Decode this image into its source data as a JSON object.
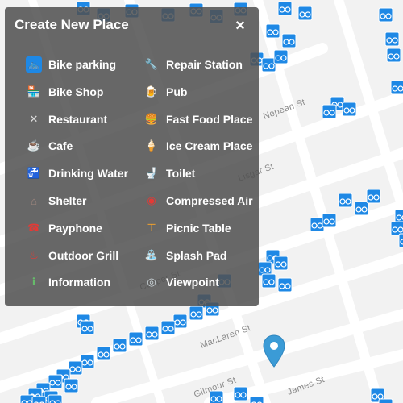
{
  "dialog": {
    "title": "Create New Place",
    "close_label": "×"
  },
  "place_types": [
    {
      "label": "Bike parking",
      "icon": "bike-parking-icon",
      "color": "#1e88e5"
    },
    {
      "label": "Repair Station",
      "icon": "repair-station-icon",
      "color": "#1e88e5"
    },
    {
      "label": "Bike Shop",
      "icon": "bike-shop-icon",
      "color": "#e57373"
    },
    {
      "label": "Pub",
      "icon": "pub-icon",
      "color": "#f9a825"
    },
    {
      "label": "Restaurant",
      "icon": "restaurant-icon",
      "color": "#dddddd"
    },
    {
      "label": "Fast Food Place",
      "icon": "fast-food-icon",
      "color": "#f57c00"
    },
    {
      "label": "Cafe",
      "icon": "cafe-icon",
      "color": "#8d6e63"
    },
    {
      "label": "Ice Cream Place",
      "icon": "ice-cream-icon",
      "color": "#ef5350"
    },
    {
      "label": "Drinking Water",
      "icon": "drinking-water-icon",
      "color": "#42a5f5"
    },
    {
      "label": "Toilet",
      "icon": "toilet-icon",
      "color": "#90caf9"
    },
    {
      "label": "Shelter",
      "icon": "shelter-icon",
      "color": "#a1887f"
    },
    {
      "label": "Compressed Air",
      "icon": "compressed-air-icon",
      "color": "#e53935"
    },
    {
      "label": "Payphone",
      "icon": "payphone-icon",
      "color": "#e53935"
    },
    {
      "label": "Picnic Table",
      "icon": "picnic-table-icon",
      "color": "#ffa726"
    },
    {
      "label": "Outdoor Grill",
      "icon": "outdoor-grill-icon",
      "color": "#e53935"
    },
    {
      "label": "Splash Pad",
      "icon": "splash-pad-icon",
      "color": "#26a69a"
    },
    {
      "label": "Information",
      "icon": "information-icon",
      "color": "#66bb6a"
    },
    {
      "label": "Viewpoint",
      "icon": "viewpoint-icon",
      "color": "#cfd8dc"
    }
  ],
  "streets": [
    "Nepean St",
    "Lisgar St",
    "Cooper St",
    "MacLaren St",
    "Gilmour St",
    "James St"
  ],
  "colors": {
    "marker": "#1e88e5",
    "pin": "#3b9bd6",
    "map_background": "#f2f2f2",
    "road": "#ffffff"
  }
}
